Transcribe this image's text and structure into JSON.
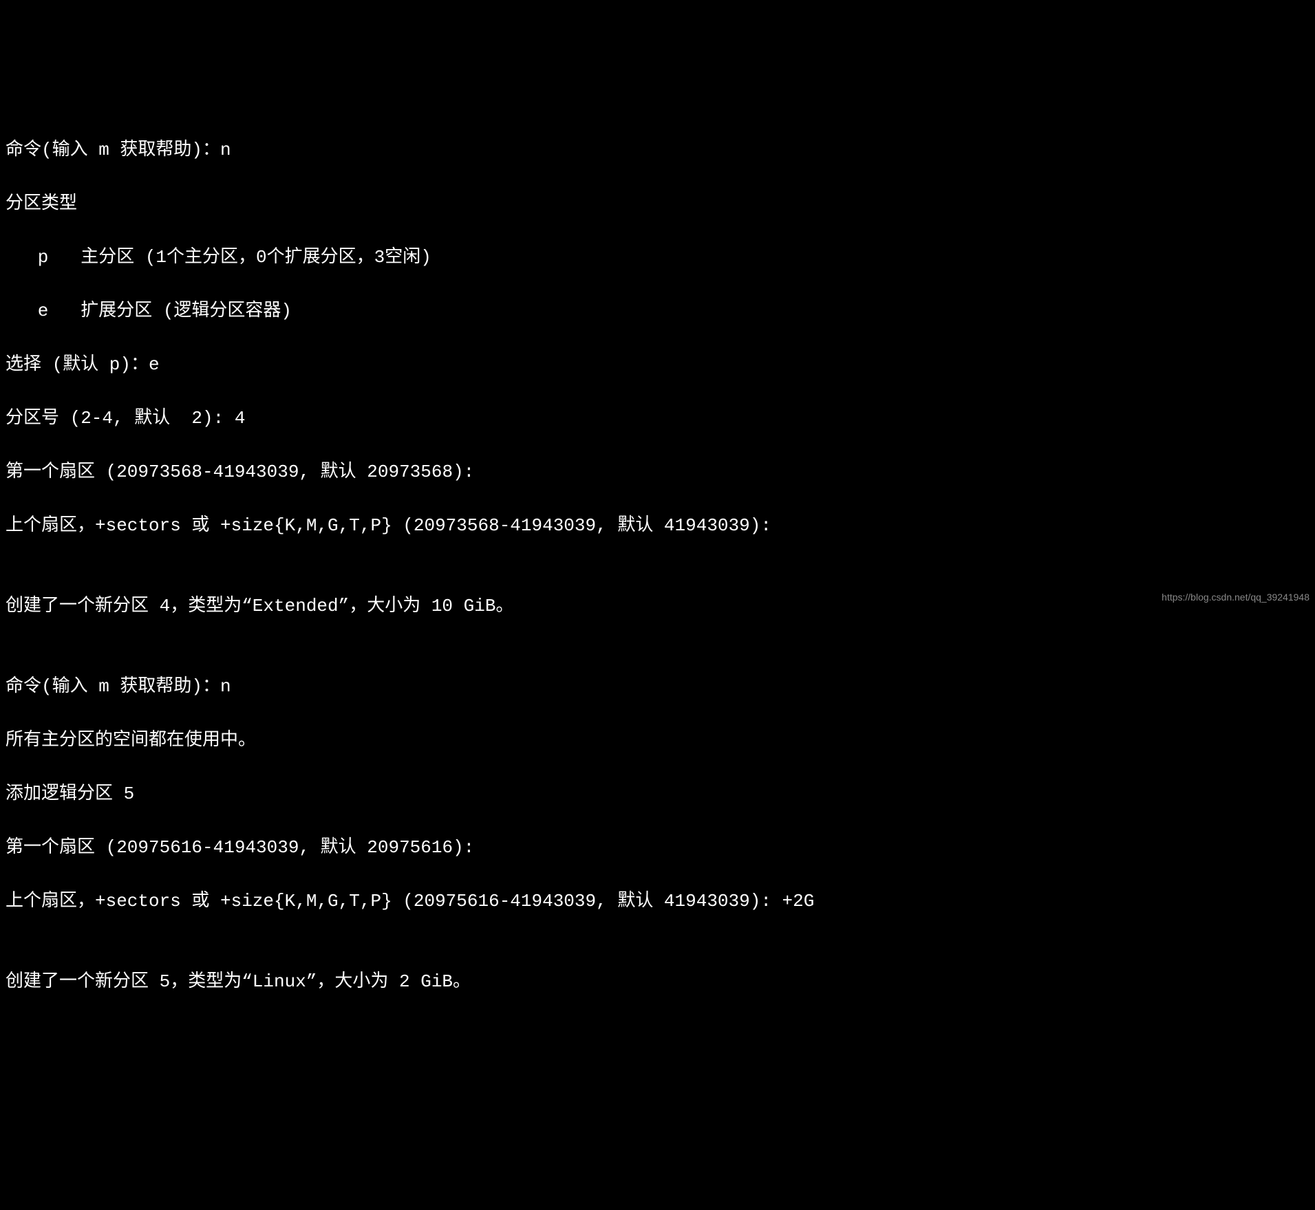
{
  "terminal": {
    "lines": [
      "命令(输入 m 获取帮助)：n",
      "分区类型",
      "   p   主分区 (1个主分区，0个扩展分区，3空闲)",
      "   e   扩展分区 (逻辑分区容器)",
      "选择 (默认 p)：e",
      "分区号 (2-4, 默认  2): 4",
      "第一个扇区 (20973568-41943039, 默认 20973568):",
      "上个扇区，+sectors 或 +size{K,M,G,T,P} (20973568-41943039, 默认 41943039):",
      "",
      "创建了一个新分区 4，类型为“Extended”，大小为 10 GiB。",
      "",
      "命令(输入 m 获取帮助)：n",
      "所有主分区的空间都在使用中。",
      "添加逻辑分区 5",
      "第一个扇区 (20975616-41943039, 默认 20975616):",
      "上个扇区，+sectors 或 +size{K,M,G,T,P} (20975616-41943039, 默认 41943039): +2G",
      "",
      "创建了一个新分区 5，类型为“Linux”，大小为 2 GiB。"
    ]
  },
  "watermark": "https://blog.csdn.net/qq_39241948"
}
